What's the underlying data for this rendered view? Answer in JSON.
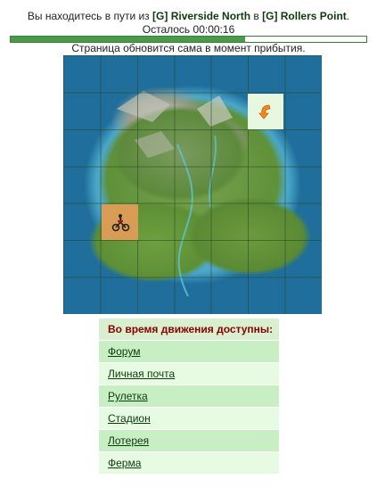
{
  "travel": {
    "prefix": "Вы находитесь в пути из",
    "from": "[G] Riverside North",
    "middle": "в",
    "to": "[G] Rollers Point",
    "suffix": ".",
    "remaining_label": "Осталось",
    "remaining_time": "00:00:16",
    "progress_fraction": 0.66,
    "note": "Страница обновится сама в момент прибытия."
  },
  "map": {
    "destination_icon": "orange-arrow-icon",
    "player_icon": "rider-icon"
  },
  "menu": {
    "header": "Во время движения доступны:",
    "items": [
      {
        "label": "Форум"
      },
      {
        "label": "Личная почта"
      },
      {
        "label": "Рулетка"
      },
      {
        "label": "Стадион"
      },
      {
        "label": "Лотерея"
      },
      {
        "label": "Ферма"
      }
    ]
  },
  "colors": {
    "header_text": "#8b0000",
    "link_text": "#0d3b0d",
    "progress_fill": "#4a9a4a",
    "destination_cell": "#e8f7e0",
    "player_cell": "#d99c55"
  }
}
